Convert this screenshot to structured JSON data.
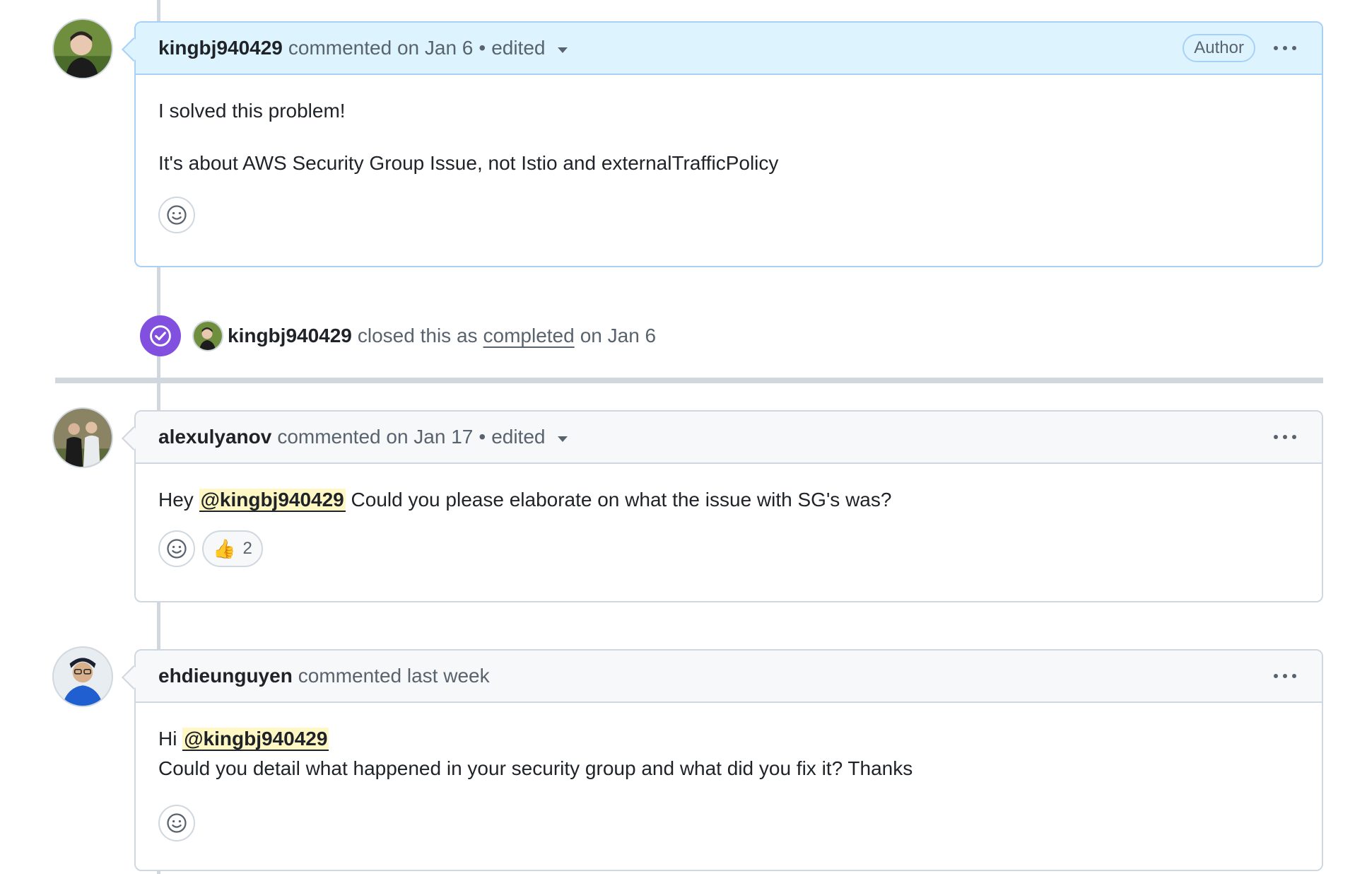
{
  "comments": [
    {
      "username": "kingbj940429",
      "action": "commented on Jan 6",
      "separator": "•",
      "edited": "edited",
      "badge": "Author",
      "paragraphs": [
        "I solved this problem!",
        "It's about AWS Security Group Issue, not Istio and externalTrafficPolicy"
      ]
    },
    {
      "username": "alexulyanov",
      "action": "commented on Jan 17",
      "separator": "•",
      "edited": "edited",
      "text_before": "Hey",
      "mention": "@kingbj940429",
      "text_after": "Could you please elaborate on what the issue with SG's was?",
      "reaction": {
        "emoji": "👍",
        "count": "2"
      }
    },
    {
      "username": "ehdieunguyen",
      "action": "commented last week",
      "text_before": "Hi",
      "mention": "@kingbj940429",
      "line2": "Could you detail what happened in your security group and what did you fix it? Thanks"
    }
  ],
  "event": {
    "username": "kingbj940429",
    "action": "closed this as",
    "link": "completed",
    "date": "on Jan 6"
  },
  "colors": {
    "closed_badge": "#8250df",
    "author_header": "#ddf4ff",
    "mention_bg": "#fff8c5"
  },
  "icons": [
    "smiley-icon",
    "kebab-icon",
    "check-circle-icon",
    "caret-down-icon",
    "thumbs-up-icon"
  ]
}
